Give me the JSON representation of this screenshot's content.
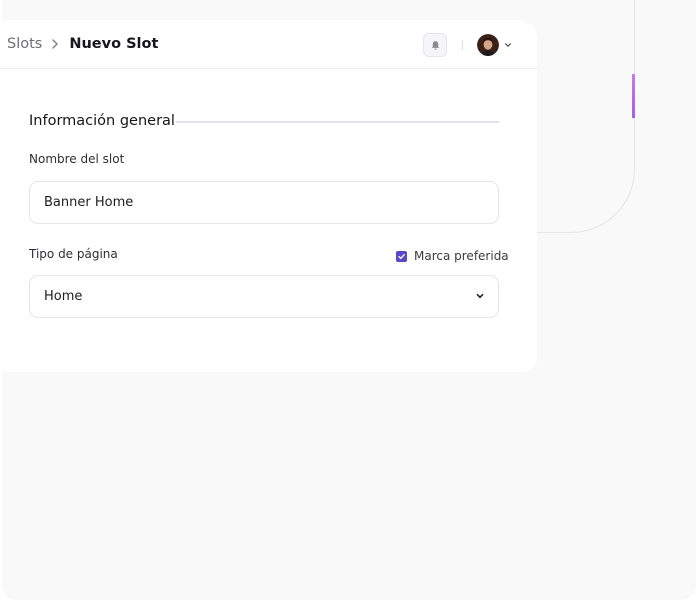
{
  "breadcrumb": {
    "parent": "Slots",
    "current": "Nuevo Slot"
  },
  "header": {
    "icons": [
      "bell-icon",
      "avatar",
      "chevron-down-icon"
    ]
  },
  "form": {
    "section_title": "Información general",
    "slot_name": {
      "label": "Nombre del slot",
      "value": "Banner Home"
    },
    "page_type": {
      "label": "Tipo de página",
      "value": "Home"
    },
    "preferred_brand": {
      "label": "Marca preferida",
      "checked": true
    }
  },
  "colors": {
    "accent": "#5b4ac7",
    "accent_strip": "#b36bea",
    "text": "#16161c",
    "muted": "#6e6e78"
  }
}
